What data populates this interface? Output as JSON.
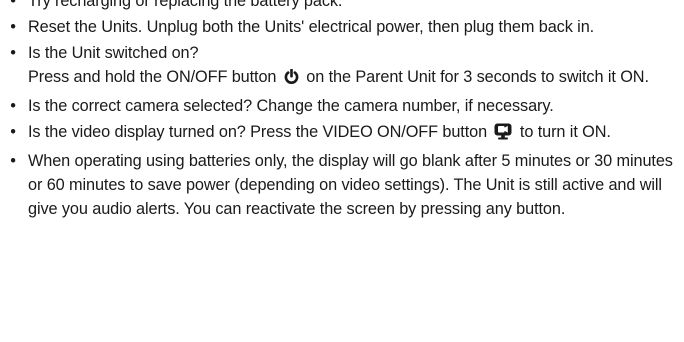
{
  "items": [
    {
      "text": "Try recharging or replacing the battery pack."
    },
    {
      "text": "Reset the Units. Unplug both the Units' electrical power, then plug them back in."
    },
    {
      "line1": "Is the Unit switched on?",
      "pre": "Press and hold the ON/OFF button",
      "post": "on the Parent Unit for 3 seconds to switch it ON.",
      "icon": "power-icon"
    },
    {
      "text": "Is the correct camera selected? Change the camera number, if necessary."
    },
    {
      "pre": "Is the video display turned on? Press the VIDEO ON/OFF button",
      "post": "to turn it ON.",
      "icon": "video-display-icon"
    },
    {
      "text": "When operating using batteries only, the display will go blank after 5 minutes or 30 minutes or 60 minutes to save power (depending on video settings). The Unit is still active and will give you audio alerts. You can reactivate the screen by pressing any button."
    }
  ],
  "bullet_char": "•"
}
